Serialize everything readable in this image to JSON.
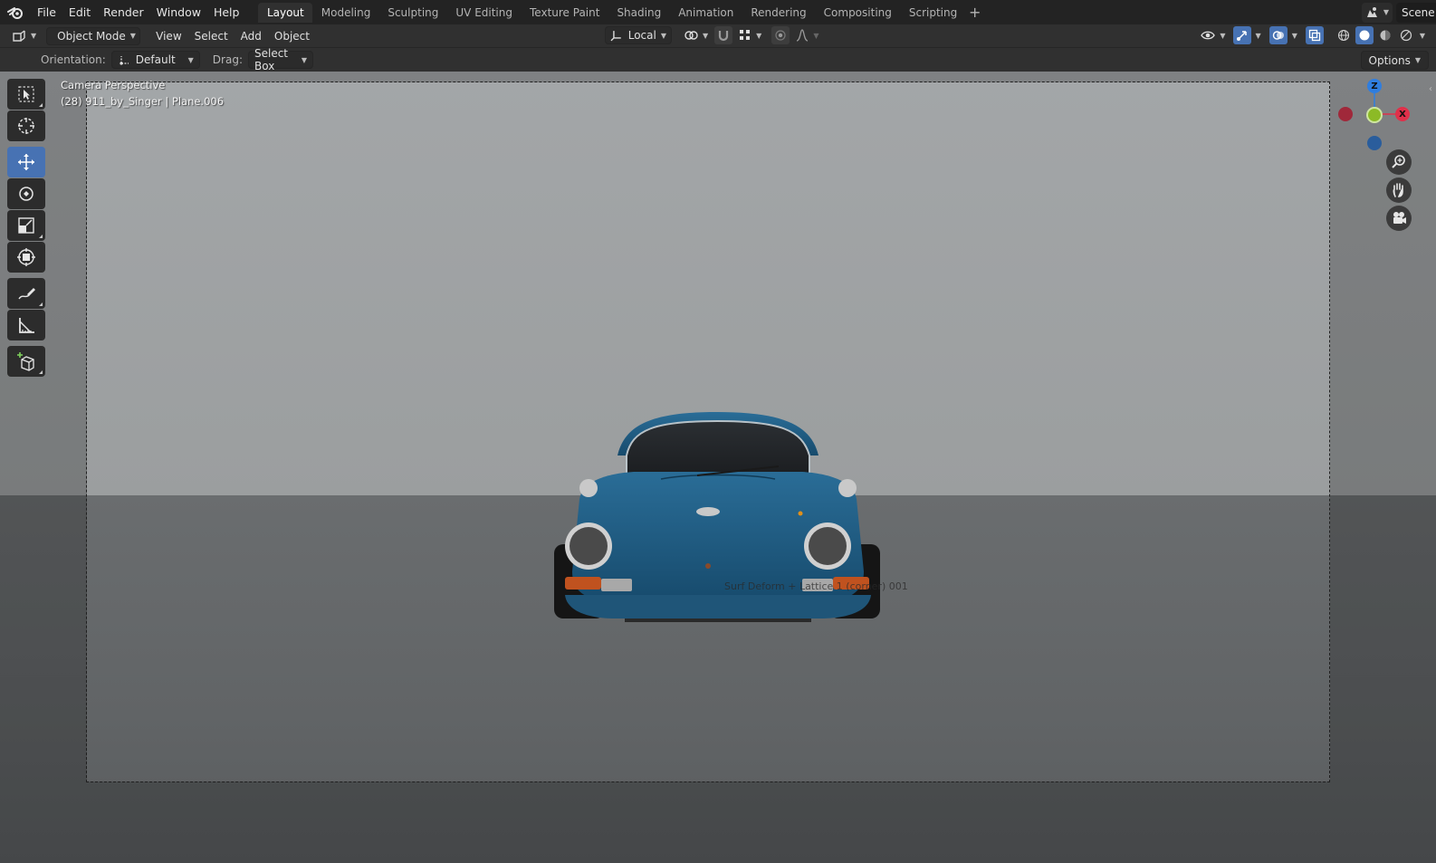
{
  "menubar": {
    "items": [
      "File",
      "Edit",
      "Render",
      "Window",
      "Help"
    ],
    "workspaces": [
      "Layout",
      "Modeling",
      "Sculpting",
      "UV Editing",
      "Texture Paint",
      "Shading",
      "Animation",
      "Rendering",
      "Compositing",
      "Scripting"
    ],
    "active_workspace": "Layout",
    "add_workspace": "+",
    "scene_label": "Scene"
  },
  "header": {
    "mode": "Object Mode",
    "menus": [
      "View",
      "Select",
      "Add",
      "Object"
    ],
    "transform_orientation": "Local"
  },
  "tool_settings": {
    "orientation_label": "Orientation:",
    "orientation_value": "Default",
    "drag_label": "Drag:",
    "drag_value": "Select Box",
    "options_label": "Options"
  },
  "viewport": {
    "perspective_label": "Camera Perspective",
    "object_info": "(28) 911_by_Singer | Plane.006",
    "modifier_label": "Surf Deform + Lattice 1 (corner) 001"
  },
  "gizmo": {
    "z": "Z",
    "x": "X",
    "colors": {
      "x": "#e0304a",
      "y": "#8cba26",
      "z": "#2f7ee0",
      "neg_x": "#a0283a",
      "neg_z": "#2a5d9c"
    }
  },
  "colors": {
    "accent": "#4772b3",
    "car_body": "#1f5e86"
  }
}
